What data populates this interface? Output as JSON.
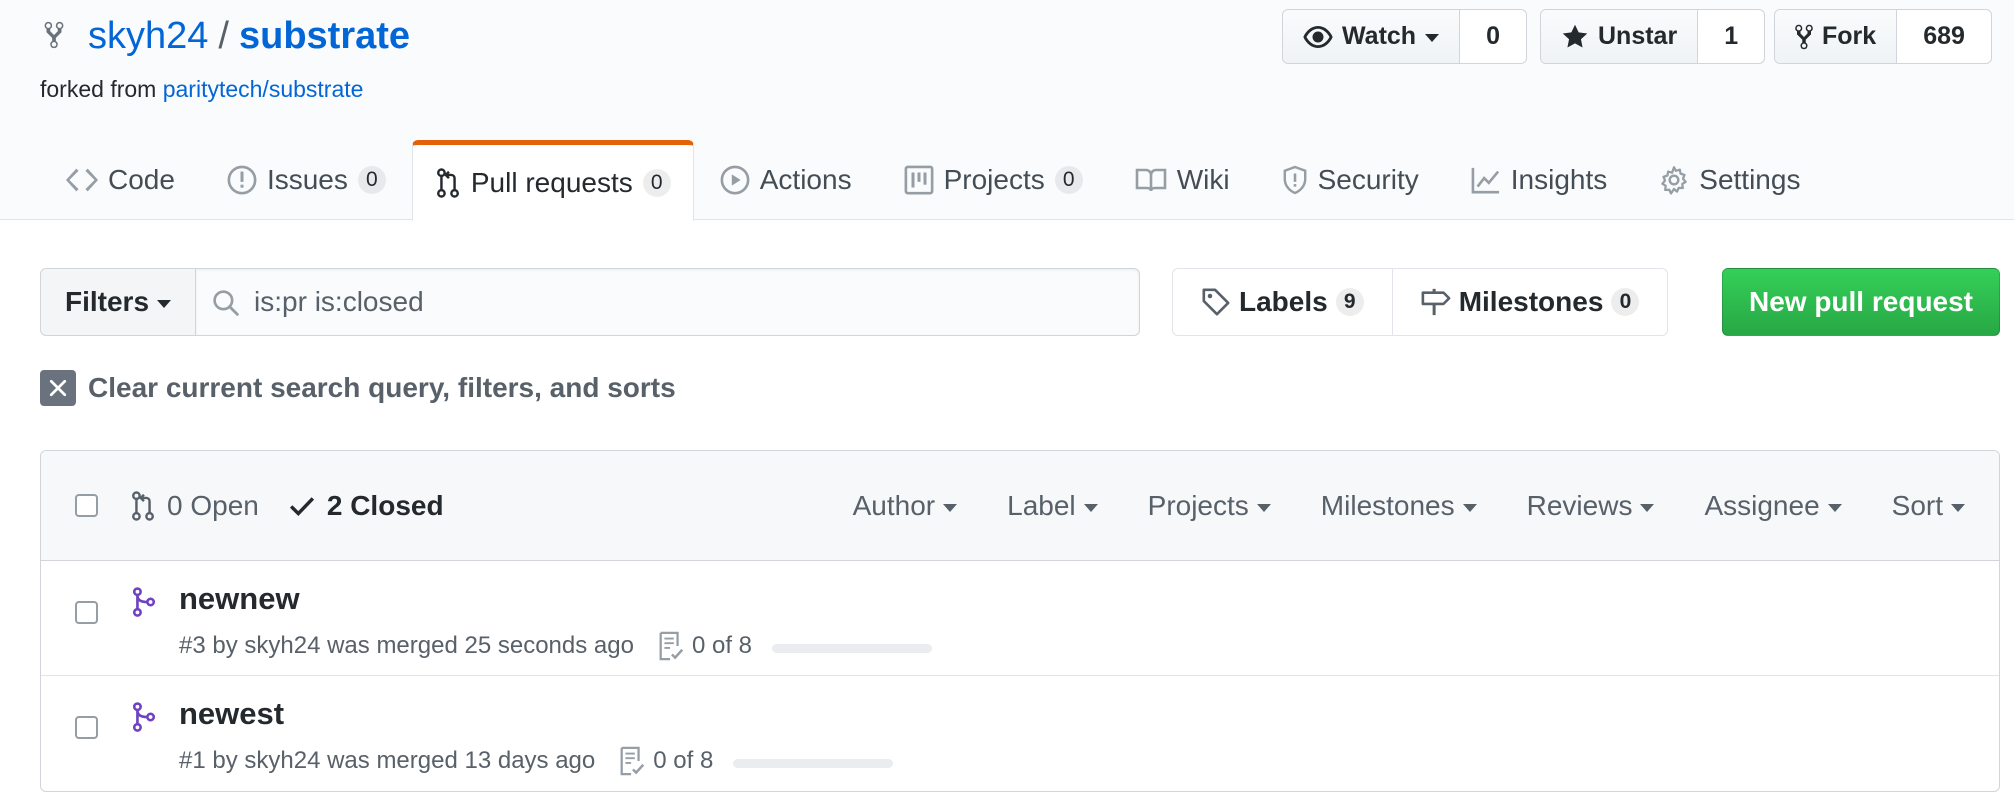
{
  "repo": {
    "owner": "skyh24",
    "separator": "/",
    "name": "substrate",
    "forked_prefix": "forked from",
    "forked_source": "paritytech/substrate"
  },
  "social": {
    "watch_label": "Watch",
    "watch_count": "0",
    "star_label": "Unstar",
    "star_count": "1",
    "fork_label": "Fork",
    "fork_count": "689"
  },
  "tabs": [
    {
      "label": "Code",
      "icon": "code-icon"
    },
    {
      "label": "Issues",
      "count": "0",
      "icon": "issue-opened-icon"
    },
    {
      "label": "Pull requests",
      "count": "0",
      "icon": "git-pull-request-icon",
      "selected": true
    },
    {
      "label": "Actions",
      "icon": "play-icon"
    },
    {
      "label": "Projects",
      "count": "0",
      "icon": "project-icon"
    },
    {
      "label": "Wiki",
      "icon": "book-icon"
    },
    {
      "label": "Security",
      "icon": "shield-icon"
    },
    {
      "label": "Insights",
      "icon": "graph-icon"
    },
    {
      "label": "Settings",
      "icon": "gear-icon"
    }
  ],
  "subnav": {
    "filters_label": "Filters",
    "search_value": "is:pr is:closed",
    "labels_label": "Labels",
    "labels_count": "9",
    "milestones_label": "Milestones",
    "milestones_count": "0",
    "new_pr_label": "New pull request",
    "clear_label": "Clear current search query, filters, and sorts"
  },
  "list_header": {
    "open_label": "0 Open",
    "closed_label": "2 Closed",
    "sorters": [
      "Author",
      "Label",
      "Projects",
      "Milestones",
      "Reviews",
      "Assignee",
      "Sort"
    ]
  },
  "pulls": [
    {
      "title": "newnew",
      "meta": "#3 by skyh24 was merged 25 seconds ago",
      "tasks": "0 of 8",
      "progress": 0
    },
    {
      "title": "newest",
      "meta": "#1 by skyh24 was merged 13 days ago",
      "tasks": "0 of 8",
      "progress": 0
    }
  ],
  "colors": {
    "link": "#0366d6",
    "tab_accent": "#e36209",
    "merged": "#6f42c1",
    "primary_button": "#28a745"
  }
}
